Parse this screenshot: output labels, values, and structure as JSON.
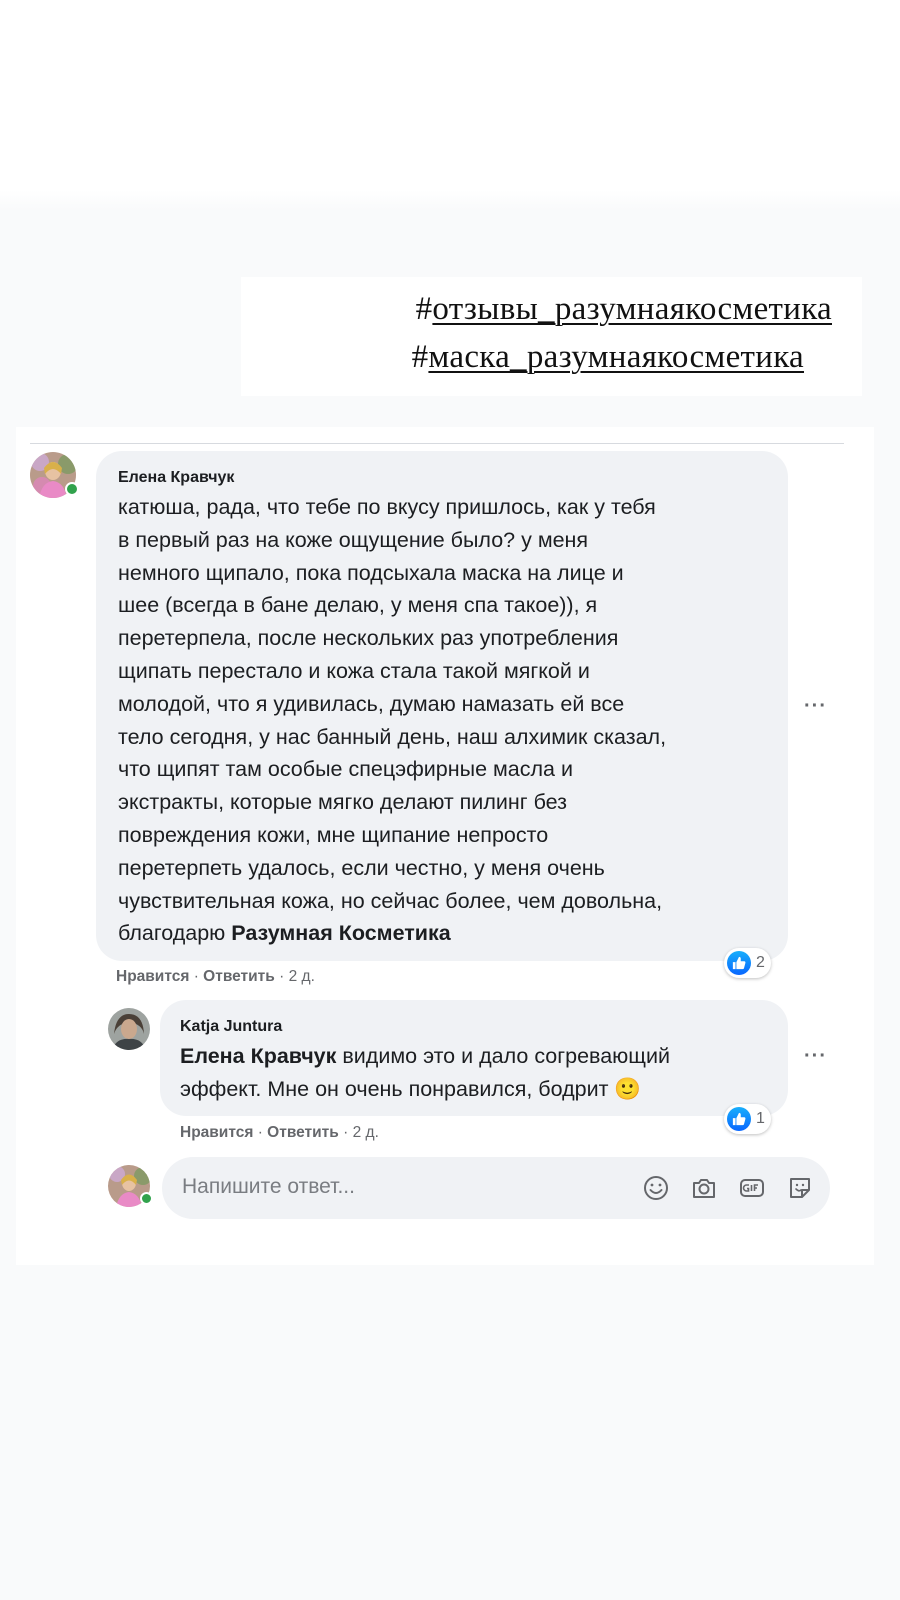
{
  "hashtags": {
    "line1_hash": "#",
    "line1_text": "отзывы_разумнаякосметика",
    "line2_hash": "#",
    "line2_text": "маска_разумнаякосметика"
  },
  "comments": [
    {
      "author": "Елена Кравчук",
      "text": "катюша, рада, что тебе по вкусу пришлось, как у тебя\nв первый раз на коже ощущение было? у меня\nнемного щипало, пока подсыхала маска на лице и\nшее (всегда в бане делаю, у меня спа такое)), я\nперетерпела, после нескольких раз употребления\nщипать перестало и кожа стала такой мягкой и\nмолодой, что я удивилась, думаю намазать ей все\nтело сегодня, у нас банный день, наш алхимик сказал,\nчто щипят там особые спецэфирные масла и\nэкстракты, которые мягко делают пилинг без\nповреждения кожи, мне щипание непросто\nперетерпеть удалось, если честно, у меня очень\nчувствительная кожа, но сейчас более, чем довольна,\nблагодарю ",
      "mention": "Разумная Косметика",
      "like_label": "Нравится",
      "sep1": " · ",
      "reply_label": "Ответить",
      "sep2": " · ",
      "time": "2 д.",
      "reaction_count": "2",
      "more": "···"
    },
    {
      "author": "Katja Juntura",
      "mention": "Елена Кравчук",
      "text": " видимо это и дало согревающий\nэффект. Мне он очень понравился, бодрит ",
      "emoji": "🙂",
      "like_label": "Нравится",
      "sep1": " · ",
      "reply_label": "Ответить",
      "sep2": " · ",
      "time": "2 д.",
      "reaction_count": "1",
      "more": "···"
    }
  ],
  "reply": {
    "placeholder": "Напишите ответ..."
  },
  "icons": [
    "emoji-icon",
    "camera-icon",
    "gif-icon",
    "sticker-icon",
    "like-icon"
  ],
  "colors": {
    "bubble": "#f0f2f5",
    "text": "#1c1e21",
    "meta": "#65676b",
    "like_blue": "#0866ff",
    "online": "#31a24c"
  }
}
